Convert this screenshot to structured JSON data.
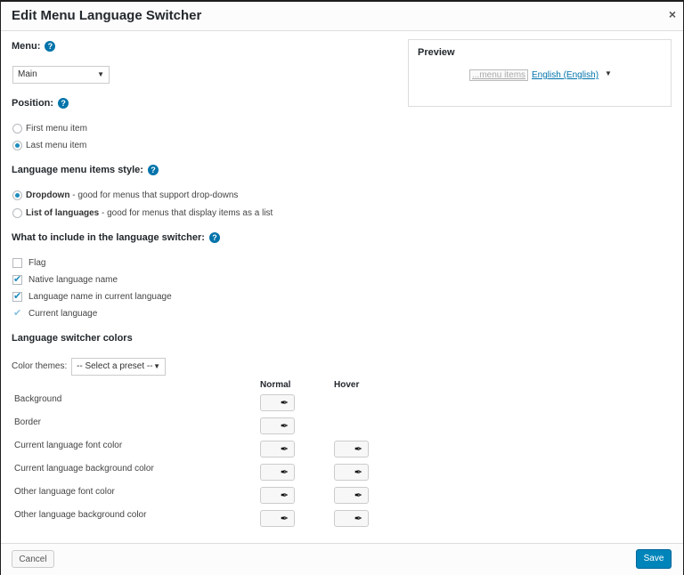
{
  "dialog": {
    "title": "Edit Menu Language Switcher",
    "close_label": "×"
  },
  "help_icon_glyph": "?",
  "menu": {
    "label": "Menu:",
    "selected": "Main"
  },
  "position": {
    "label": "Position:",
    "options": [
      {
        "label": "First menu item",
        "checked": false
      },
      {
        "label": "Last menu item",
        "checked": true
      }
    ]
  },
  "style": {
    "label": "Language menu items style:",
    "options": [
      {
        "bold": "Dropdown",
        "desc": " - good for menus that support drop-downs",
        "checked": true
      },
      {
        "bold": "List of languages",
        "desc": " - good for menus that display items as a list",
        "checked": false
      }
    ]
  },
  "include": {
    "label": "What to include in the language switcher:",
    "options": [
      {
        "label": "Flag",
        "checked": false
      },
      {
        "label": "Native language name",
        "checked": true
      },
      {
        "label": "Language name in current language",
        "checked": true
      },
      {
        "label": "Current language",
        "checked": true,
        "disabled": true
      }
    ]
  },
  "colors": {
    "label": "Language switcher colors",
    "themes_label": "Color themes:",
    "preset_selected": "-- Select a preset --",
    "col_normal": "Normal",
    "col_hover": "Hover",
    "rows": [
      "Background",
      "Border",
      "Current language font color",
      "Current language background color",
      "Other language font color",
      "Other language background color"
    ]
  },
  "preview": {
    "title": "Preview",
    "menu_items": "...menu items",
    "language_link": "English (English)",
    "caret": "▼"
  },
  "footer": {
    "cancel_label": "Cancel",
    "save_label": "Save"
  },
  "theme_colors": {
    "accent": "#0073aa",
    "button": "#0085ba"
  }
}
